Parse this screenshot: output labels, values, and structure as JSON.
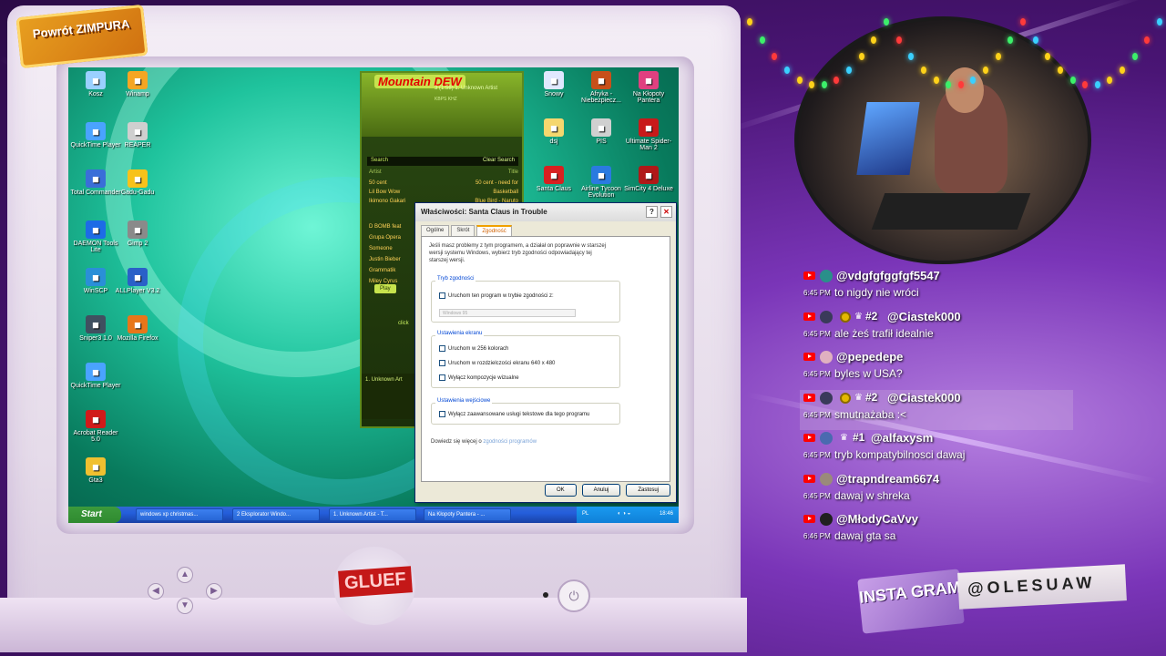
{
  "overlay": {
    "logo_text": "Powrót ZIMPURA",
    "instagram_label": "INSTA GRAM",
    "instagram_handle": "@OLESUAW",
    "sticker_text": "GLUEF"
  },
  "desktop": {
    "icons": [
      {
        "label": "Kosz",
        "icon": "recycle-bin-icon",
        "color": "#9ad0ff"
      },
      {
        "label": "Winamp",
        "icon": "winamp-icon",
        "color": "#f5a623"
      },
      {
        "label": "QuickTime Player",
        "icon": "quicktime-icon",
        "color": "#4aa3ff"
      },
      {
        "label": "REAPER",
        "icon": "reaper-icon",
        "color": "#cfcfcf"
      },
      {
        "label": "Total Commander",
        "icon": "total-commander-icon",
        "color": "#3a6ed8"
      },
      {
        "label": "Gadu-Gadu",
        "icon": "gadu-gadu-icon",
        "color": "#f7c21a"
      },
      {
        "label": "DAEMON Tools Lite",
        "icon": "daemon-tools-icon",
        "color": "#1d6be6"
      },
      {
        "label": "Gimp 2",
        "icon": "gimp-icon",
        "color": "#8a8a8a"
      },
      {
        "label": "WinSCP",
        "icon": "winscp-icon",
        "color": "#2a8fd8"
      },
      {
        "label": "ALLPlayer V3.2",
        "icon": "allplayer-icon",
        "color": "#2a60c8"
      },
      {
        "label": "Sniper3 1.0",
        "icon": "sniper-icon",
        "color": "#405060"
      },
      {
        "label": "Mozilla Firefox",
        "icon": "firefox-icon",
        "color": "#e8761a"
      },
      {
        "label": "QuickTime Player",
        "icon": "quicktime-icon",
        "color": "#4aa3ff"
      },
      {
        "label": "Acrobat Reader 5.0",
        "icon": "acrobat-icon",
        "color": "#d01a1a"
      },
      {
        "label": "Gta3",
        "icon": "gta-icon",
        "color": "#f0c030"
      },
      {
        "label": "Snowy",
        "icon": "snowy-icon",
        "color": "#e0e8ff"
      },
      {
        "label": "Afryka - Niebezpiecz...",
        "icon": "game-icon",
        "color": "#c8501a"
      },
      {
        "label": "Na Kłopoty Pantera",
        "icon": "pantera-icon",
        "color": "#e04080"
      },
      {
        "label": "dsj",
        "icon": "folder-icon",
        "color": "#f5d76e"
      },
      {
        "label": "PIS",
        "icon": "pis-icon",
        "color": "#d0d0d0"
      },
      {
        "label": "Ultimate Spider-Man 2",
        "icon": "spiderman-icon",
        "color": "#c81a1a"
      },
      {
        "label": "Santa Claus",
        "icon": "santa-claus-icon",
        "color": "#d82020"
      },
      {
        "label": "Airline Tycoon Evolution",
        "icon": "airline-icon",
        "color": "#2a7ae0"
      },
      {
        "label": "SimCity 4 Deluxe",
        "icon": "simcity-icon",
        "color": "#b01818"
      }
    ]
  },
  "winamp": {
    "logo": "Mountain DEW",
    "track": "1. Unknown Artist",
    "elapsed": "3 (1:58)",
    "kbps": "KBPS KHZ",
    "search_label": "Search",
    "clear_search": "Clear Search",
    "columns": [
      "Artist",
      "Title"
    ],
    "rows": [
      {
        "artist": "50 cent",
        "title": "50 cent - need for"
      },
      {
        "artist": "Lil Bow Wow",
        "title": "Basketball"
      },
      {
        "artist": "Ikimono Gakari",
        "title": "Blue Bird - Naruto"
      },
      {
        "artist": "D BOMB feat",
        "title": ""
      },
      {
        "artist": "Grupa Opera",
        "title": ""
      },
      {
        "artist": "Someone",
        "title": ""
      },
      {
        "artist": "Justin Bieber",
        "title": ""
      },
      {
        "artist": "Grammatik",
        "title": ""
      },
      {
        "artist": "Miley Cyrus",
        "title": ""
      }
    ],
    "play_label": "Play",
    "click_label": "click",
    "now_playing": "1. Unknown Art"
  },
  "dialog": {
    "title": "Właściwości: Santa Claus in Trouble",
    "help": "?",
    "close": "✕",
    "tabs": [
      "Ogólne",
      "Skrót",
      "Zgodność"
    ],
    "intro": "Jeśli masz problemy z tym programem, a działał on poprawnie w starszej wersji systemu Windows, wybierz tryb zgodności odpowiadający tej starszej wersji.",
    "group1_title": "Tryb zgodności",
    "group1_check": "Uruchom ten program w trybie zgodności z:",
    "group1_select": "Windows 95",
    "group2_title": "Ustawienia ekranu",
    "group2_checks": [
      "Uruchom w 256 kolorach",
      "Uruchom w rozdzielczości ekranu 640 x 480",
      "Wyłącz kompozycje wizualne"
    ],
    "group3_title": "Ustawienia wejściowe",
    "group3_check": "Wyłącz zaawansowane usługi tekstowe dla tego programu",
    "more_prefix": "Dowiedz się więcej o",
    "more_link": "zgodności programów",
    "ok": "OK",
    "cancel": "Anuluj",
    "apply": "Zastosuj"
  },
  "taskbar": {
    "start": "Start",
    "tasks": [
      "windows xp christmas...",
      "2 Eksplorator Windo...",
      "1. Unknown Artist - T...",
      "Na Kłopoty Pantera - ..."
    ],
    "lang": "PL",
    "clock": "18:46"
  },
  "chat": {
    "messages": [
      {
        "user": "@vdgfgfggfgf5547",
        "time": "6:45 PM",
        "text": "to nigdy nie wróci",
        "badges": false,
        "rank": "",
        "avatar": "#2a8f8a",
        "hl": false
      },
      {
        "user": "@Ciastek000",
        "time": "6:45 PM",
        "text": "ale żeś trafił idealnie",
        "badges": true,
        "rank": "#2",
        "avatar": "#3a3a5a",
        "hl": false
      },
      {
        "user": "@pepedepe",
        "time": "6:45 PM",
        "text": "byles w USA?",
        "badges": false,
        "rank": "",
        "avatar": "#e0b0c0",
        "hl": false
      },
      {
        "user": "@Ciastek000",
        "time": "6:45 PM",
        "text": "smutnażaba :<",
        "badges": true,
        "rank": "#2",
        "avatar": "#3a3a5a",
        "hl": true
      },
      {
        "user": "@alfaxysm",
        "time": "6:45 PM",
        "text": "tryb kompatybilnosci dawaj",
        "badges": "crown",
        "rank": "#1",
        "avatar": "#4a6ab0",
        "hl": false
      },
      {
        "user": "@trapndream6674",
        "time": "6:45 PM",
        "text": "dawaj w shreka",
        "badges": false,
        "rank": "",
        "avatar": "#9a8a7a",
        "hl": false
      },
      {
        "user": "@MłodyCaVvy",
        "time": "6:46 PM",
        "text": "dawaj gta sa",
        "badges": false,
        "rank": "",
        "avatar": "#202020",
        "hl": false
      }
    ]
  }
}
